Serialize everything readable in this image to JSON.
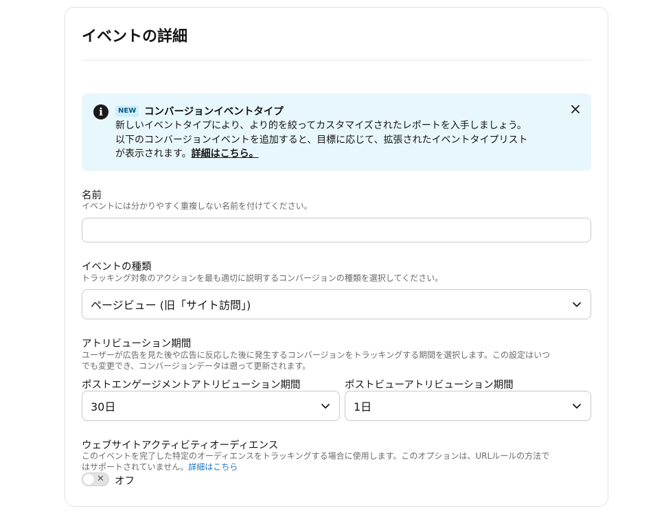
{
  "card": {
    "title": "イベントの詳細"
  },
  "banner": {
    "badge": "NEW",
    "title": "コンバージョンイベントタイプ",
    "body_line1": "新しいイベントタイプにより、より的を絞ってカスタマイズされたレポートを入手しましょう。",
    "body_line2": "以下のコンバージョンイベントを追加すると、目標に応じて、拡張されたイベントタイプリスト",
    "body_line3": "が表示されます。",
    "link": "詳細はこちら。",
    "info_icon": "info-icon",
    "close_icon": "close-icon"
  },
  "name_field": {
    "label": "名前",
    "help": "イベントには分かりやすく重複しない名前を付けてください。",
    "value": "",
    "placeholder": ""
  },
  "event_type": {
    "label": "イベントの種類",
    "help": "トラッキング対象のアクションを最も適切に説明するコンバージョンの種類を選択してください。",
    "selected": "ページビュー (旧「サイト訪問」)"
  },
  "attribution": {
    "label": "アトリビューション期間",
    "help_line1": "ユーザーが広告を見た後や広告に反応した後に発生するコンバージョンをトラッキングする期間を選択します。この設定はいつ",
    "help_line2": "でも変更でき、コンバージョンデータは遡って更新されます。",
    "engagement_label": "ポストエンゲージメントアトリビューション期間",
    "engagement_value": "30日",
    "view_label": "ポストビューアトリビューション期間",
    "view_value": "1日"
  },
  "audience": {
    "label": "ウェブサイトアクティビティオーディエンス",
    "help_line1": "このイベントを完了した特定のオーディエンスをトラッキングする場合に使用します。このオプションは、URLルールの方法で",
    "help_line2": "はサポートされていません。",
    "help_link": "詳細はこちら",
    "toggle_state": "オフ"
  },
  "colors": {
    "banner_bg": "#e8f7fc",
    "link_blue": "#1a73c8",
    "border": "#c8c8c8"
  }
}
